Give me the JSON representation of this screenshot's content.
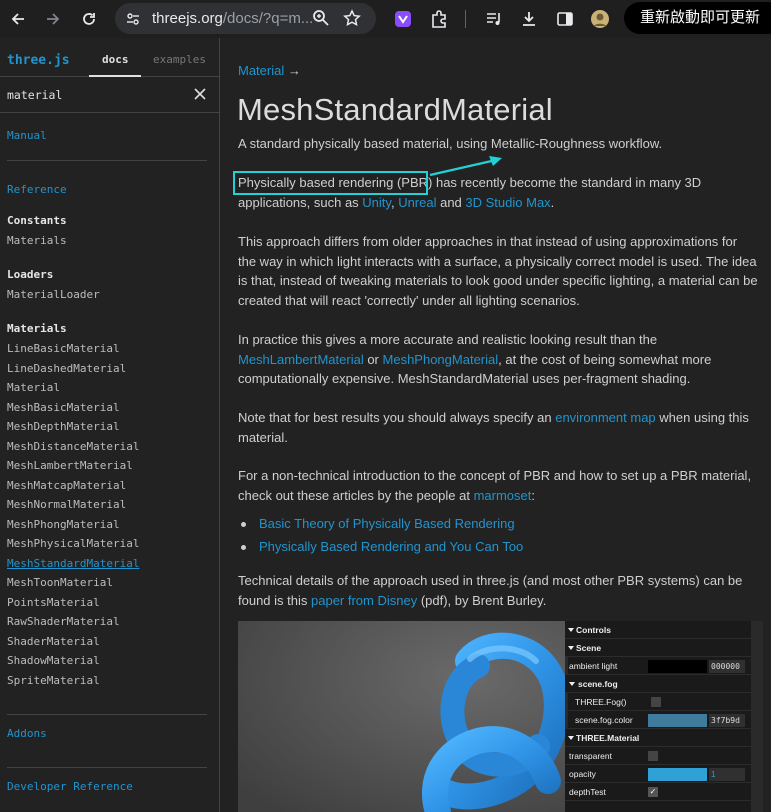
{
  "browser": {
    "url_host": "threejs.org",
    "url_path": "/docs/?q=m...",
    "update_button": "重新啟動即可更新"
  },
  "sidebar": {
    "brand": "three.js",
    "tabs": [
      "docs",
      "examples"
    ],
    "search_value": "material",
    "manual": "Manual",
    "reference": "Reference",
    "sections": [
      {
        "title": "Constants",
        "items": [
          "Materials"
        ]
      },
      {
        "title": "Loaders",
        "items": [
          "MaterialLoader"
        ]
      },
      {
        "title": "Materials",
        "items": [
          "LineBasicMaterial",
          "LineDashedMaterial",
          "Material",
          "MeshBasicMaterial",
          "MeshDepthMaterial",
          "MeshDistanceMaterial",
          "MeshLambertMaterial",
          "MeshMatcapMaterial",
          "MeshNormalMaterial",
          "MeshPhongMaterial",
          "MeshPhysicalMaterial",
          "MeshStandardMaterial",
          "MeshToonMaterial",
          "PointsMaterial",
          "RawShaderMaterial",
          "ShaderMaterial",
          "ShadowMaterial",
          "SpriteMaterial"
        ]
      }
    ],
    "active_item": "MeshStandardMaterial",
    "addons": "Addons",
    "developer_reference": "Developer Reference"
  },
  "main": {
    "breadcrumb": "Material",
    "breadcrumb_arrow": "→",
    "title": "MeshStandardMaterial",
    "intro": "A standard physically based material, using Metallic-Roughness workflow.",
    "p1": {
      "a": "Physically based rendering (PBR) has recently become the standard in many 3D applications, such as ",
      "link1": "Unity",
      "b": ", ",
      "link2": "Unreal",
      "c": " and ",
      "link3": "3D Studio Max",
      "d": "."
    },
    "p2": "This approach differs from older approaches in that instead of using approximations for the way in which light interacts with a surface, a physically correct model is used. The idea is that, instead of tweaking materials to look good under specific lighting, a material can be created that will react 'correctly' under all lighting scenarios.",
    "p3": {
      "a": "In practice this gives a more accurate and realistic looking result than the ",
      "link1": "MeshLambertMaterial",
      "b": " or ",
      "link2": "MeshPhongMaterial",
      "c": ", at the cost of being somewhat more computationally expensive. MeshStandardMaterial uses per-fragment shading."
    },
    "p4": {
      "a": "Note that for best results you should always specify an ",
      "link1": "environment map",
      "b": " when using this material."
    },
    "p5": {
      "a": "For a non-technical introduction to the concept of PBR and how to set up a PBR material, check out these articles by the people at ",
      "link1": "marmoset",
      "b": ":"
    },
    "bullets": [
      "Basic Theory of Physically Based Rendering",
      "Physically Based Rendering and You Can Too"
    ],
    "p6": {
      "a": "Technical details of the approach used in three.js (and most other PBR systems) can be found is this ",
      "link1": "paper from Disney",
      "b": " (pdf), by Brent Burley."
    }
  },
  "gui": {
    "controls": "Controls",
    "scene": "Scene",
    "ambient_light_label": "ambient light",
    "ambient_light_value": "000000",
    "fog_folder": "scene.fog",
    "fog_label": "THREE.Fog()",
    "fog_color_label": "scene.fog.color",
    "fog_color_value": "3f7b9d",
    "material_folder": "THREE.Material",
    "transparent_label": "transparent",
    "opacity_label": "opacity",
    "opacity_value": "1",
    "depthtest_label": "depthTest",
    "colors": {
      "ambient": "#000000",
      "fog": "#3f7b9d",
      "accent": "#2194ce",
      "highlight": "#22d0d6"
    }
  }
}
